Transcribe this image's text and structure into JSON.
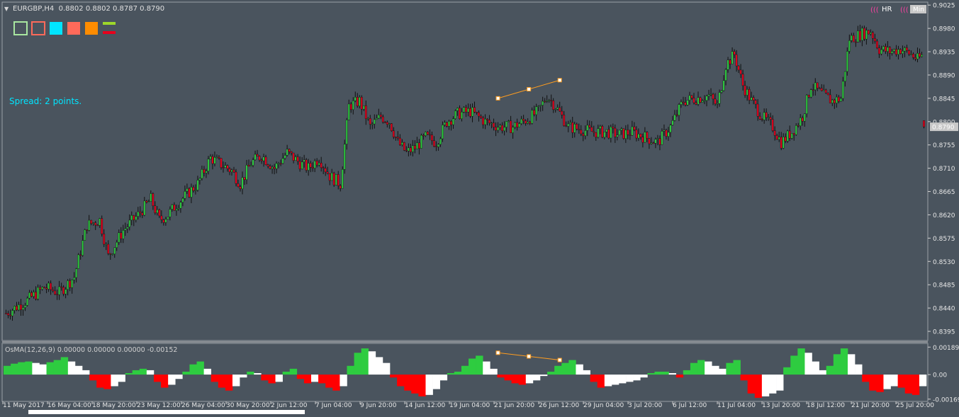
{
  "header": {
    "symbol_info": "EURGBP,H4  0.8802 0.8802 0.8787 0.8790",
    "spread": "Spread: 2 points.",
    "indicator_info": "OsMA(12,26,9) 0.00000 0.00000 0.00000 -0.00152",
    "badges": [
      {
        "icon": "(((",
        "label": "HR"
      },
      {
        "icon": "(((",
        "label": "Min"
      }
    ]
  },
  "toolbar_swatches": [
    "#a8e6a0",
    "#ff6a5a",
    "#00e5ff",
    "#ff6a5a",
    "#ff8c00"
  ],
  "colors": {
    "background": "#4a545e",
    "bull_candle": "#2ecc40",
    "bear_candle": "#e8001c",
    "wick": "#111111",
    "osma_positive_rising": "#2ecc40",
    "osma_positive_falling": "#ffffff",
    "osma_negative_falling": "#ff0000",
    "osma_negative_rising": "#ffffff",
    "trendline": "#ff9d1f",
    "spread_text": "#00e5ff",
    "current_price_label_bg": "#c8c8c8"
  },
  "chart_data": [
    {
      "type": "candlestick",
      "title": "EURGBP,H4",
      "y_ticks": [
        "0.9025",
        "0.8980",
        "0.8935",
        "0.8890",
        "0.8845",
        "0.8800",
        "0.8755",
        "0.8710",
        "0.8665",
        "0.8620",
        "0.8575",
        "0.8530",
        "0.8485",
        "0.8440",
        "0.8395"
      ],
      "ylim": [
        0.838,
        0.9028
      ],
      "current_price": "0.8790",
      "last_bar": {
        "open": 0.8802,
        "high": 0.8802,
        "low": 0.8787,
        "close": 0.879
      },
      "x_ticks": [
        "11 May 2017",
        "16 May 04:00",
        "18 May 20:00",
        "23 May 12:00",
        "26 May 04:00",
        "30 May 20:00",
        "2 Jun 12:00",
        "7 Jun 04:00",
        "9 Jun 20:00",
        "14 Jun 12:00",
        "19 Jun 04:00",
        "21 Jun 20:00",
        "26 Jun 12:00",
        "29 Jun 04:00",
        "3 Jul 20:00",
        "6 Jul 12:00",
        "11 Jul 04:00",
        "13 Jul 20:00",
        "18 Jul 12:00",
        "21 Jul 20:00",
        "25 Jul 20:00"
      ],
      "close_path": [
        [
          0,
          0.843
        ],
        [
          10,
          0.8455
        ],
        [
          18,
          0.848
        ],
        [
          25,
          0.847
        ],
        [
          32,
          0.85
        ],
        [
          38,
          0.86
        ],
        [
          44,
          0.861
        ],
        [
          48,
          0.854
        ],
        [
          55,
          0.859
        ],
        [
          62,
          0.862
        ],
        [
          68,
          0.865
        ],
        [
          72,
          0.861
        ],
        [
          76,
          0.862
        ],
        [
          80,
          0.864
        ],
        [
          85,
          0.866
        ],
        [
          90,
          0.868
        ],
        [
          96,
          0.873
        ],
        [
          102,
          0.8715
        ],
        [
          106,
          0.8705
        ],
        [
          110,
          0.868
        ],
        [
          115,
          0.872
        ],
        [
          120,
          0.8735
        ],
        [
          126,
          0.871
        ],
        [
          132,
          0.874
        ],
        [
          138,
          0.872
        ],
        [
          142,
          0.871
        ],
        [
          147,
          0.873
        ],
        [
          152,
          0.8695
        ],
        [
          157,
          0.868
        ],
        [
          161,
          0.883
        ],
        [
          166,
          0.884
        ],
        [
          171,
          0.879
        ],
        [
          176,
          0.881
        ],
        [
          180,
          0.88
        ],
        [
          184,
          0.876
        ],
        [
          188,
          0.874
        ],
        [
          192,
          0.875
        ],
        [
          197,
          0.877
        ],
        [
          202,
          0.876
        ],
        [
          207,
          0.88
        ],
        [
          212,
          0.8815
        ],
        [
          218,
          0.882
        ],
        [
          225,
          0.88
        ],
        [
          232,
          0.879
        ],
        [
          238,
          0.879
        ],
        [
          245,
          0.8805
        ],
        [
          250,
          0.882
        ],
        [
          254,
          0.885
        ],
        [
          258,
          0.883
        ],
        [
          264,
          0.879
        ],
        [
          270,
          0.8785
        ],
        [
          276,
          0.878
        ],
        [
          282,
          0.878
        ],
        [
          288,
          0.8775
        ],
        [
          294,
          0.878
        ],
        [
          300,
          0.877
        ],
        [
          306,
          0.876
        ],
        [
          312,
          0.879
        ],
        [
          318,
          0.884
        ],
        [
          324,
          0.8845
        ],
        [
          330,
          0.885
        ],
        [
          334,
          0.883
        ],
        [
          338,
          0.891
        ],
        [
          342,
          0.893
        ],
        [
          346,
          0.887
        ],
        [
          350,
          0.884
        ],
        [
          355,
          0.881
        ],
        [
          360,
          0.879
        ],
        [
          364,
          0.876
        ],
        [
          369,
          0.878
        ],
        [
          374,
          0.881
        ],
        [
          378,
          0.887
        ],
        [
          384,
          0.885
        ],
        [
          388,
          0.884
        ],
        [
          392,
          0.8845
        ],
        [
          396,
          0.896
        ],
        [
          402,
          0.897
        ],
        [
          406,
          0.8975
        ],
        [
          410,
          0.894
        ],
        [
          415,
          0.8935
        ],
        [
          420,
          0.894
        ],
        [
          425,
          0.893
        ],
        [
          428,
          0.892
        ],
        [
          431,
          0.893
        ]
      ],
      "trendline": {
        "start": [
          0.8845,
          "20 Jun"
        ],
        "end": [
          0.888,
          "26 Jun"
        ]
      }
    },
    {
      "type": "histogram",
      "title": "OsMA(12,26,9)",
      "y_ticks": [
        "0.00189",
        "0.00",
        "-0.00169"
      ],
      "ylim": [
        -0.00175,
        0.00205
      ],
      "values": [
        0.0006,
        0.00075,
        0.00085,
        0.0009,
        0.0008,
        0.0007,
        0.00085,
        0.001,
        0.0012,
        0.0009,
        0.0006,
        0.0003,
        -0.0004,
        -0.0009,
        -0.001,
        -0.0008,
        -0.0005,
        0.0001,
        0.0003,
        0.0004,
        0.0003,
        -0.0005,
        -0.0009,
        -0.0007,
        -0.0003,
        0.0002,
        0.0007,
        0.0009,
        0.0004,
        -0.0005,
        -0.0009,
        -0.0011,
        -0.0008,
        -0.0002,
        0.0002,
        0.0001,
        -0.0004,
        -0.0006,
        -0.0005,
        0.0002,
        0.0004,
        -0.0003,
        -0.0006,
        -0.0005,
        -0.0006,
        -0.0009,
        -0.0011,
        -0.0008,
        0.0006,
        0.0015,
        0.0018,
        0.0016,
        0.0012,
        0.0008,
        -0.0002,
        -0.0008,
        -0.0011,
        -0.0013,
        -0.0015,
        -0.0014,
        -0.001,
        -0.0004,
        0.0001,
        0.0002,
        0.0006,
        0.0011,
        0.0013,
        0.0009,
        0.0004,
        -0.0002,
        -0.0004,
        -0.0006,
        -0.0007,
        -0.0006,
        -0.0004,
        -0.0001,
        0.0002,
        0.0006,
        0.0008,
        0.001,
        0.0007,
        0.0003,
        -0.0005,
        -0.0009,
        -0.0008,
        -0.0007,
        -0.0006,
        -0.0005,
        -0.0004,
        -0.0002,
        0.0001,
        0.0002,
        0.0002,
        0.0001,
        -0.0002,
        0.0003,
        0.0008,
        0.001,
        0.0009,
        0.0006,
        0.0004,
        0.0008,
        0.001,
        -0.0004,
        -0.0013,
        -0.0016,
        -0.0015,
        -0.0013,
        -0.0011,
        0.0005,
        0.0013,
        0.0018,
        0.0015,
        0.0009,
        0.0003,
        0.0006,
        0.0014,
        0.0018,
        0.0014,
        0.0007,
        -0.0005,
        -0.0011,
        -0.0012,
        -0.001,
        -0.0008,
        -0.0009,
        -0.0013,
        -0.0014,
        -0.0008
      ],
      "trendline": {
        "start": [
          0.0015,
          "20 Jun"
        ],
        "end": [
          0.001,
          "26 Jun"
        ]
      }
    }
  ]
}
